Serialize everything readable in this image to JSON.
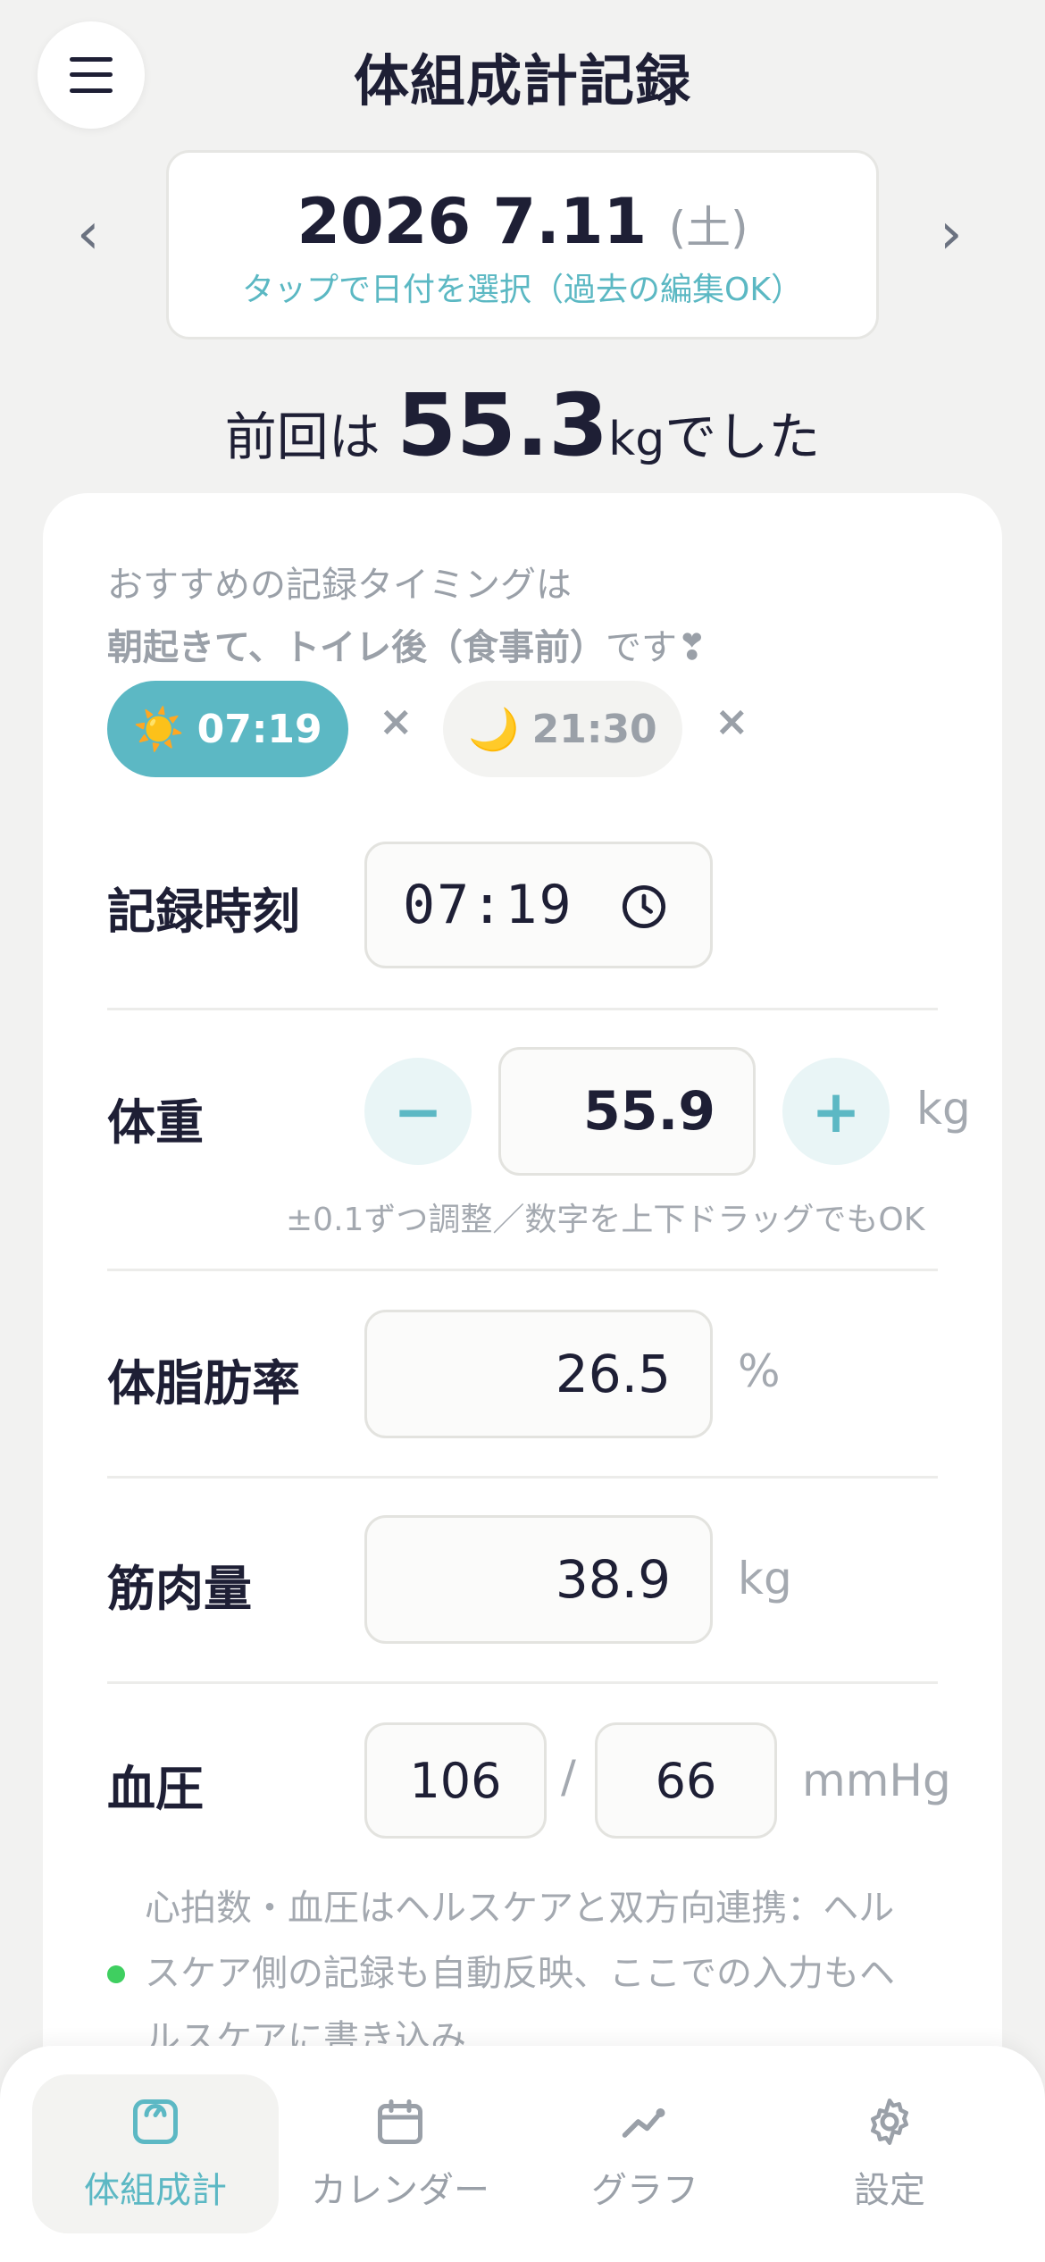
{
  "header": {
    "title": "体組成計記録",
    "menu_icon": "hamburger-menu-icon"
  },
  "date_nav": {
    "prev_glyph": "‹",
    "next_glyph": "›",
    "date": "2026 7.11",
    "weekday": "(土)",
    "hint": "タップで日付を選択（過去の編集OK）"
  },
  "previous": {
    "prefix": "前回は",
    "value": "55.3",
    "unit": "kg",
    "suffix": "でした"
  },
  "timing": {
    "line1": "おすすめの記録タイミングは",
    "line2_bold": "朝起きて、トイレ後（食事前）",
    "line2_rest": "です❣",
    "morning": {
      "emoji": "☀️",
      "time": "07:19"
    },
    "night": {
      "emoji": "🌙",
      "time": "21:30"
    },
    "remove_glyph": "×"
  },
  "record_time": {
    "label": "記録時刻",
    "value": "07:19"
  },
  "weight": {
    "label": "体重",
    "minus": "−",
    "plus": "+",
    "value": "55.9",
    "unit": "kg",
    "hint": "±0.1ずつ調整／数字を上下ドラッグでもOK"
  },
  "body_fat": {
    "label": "体脂肪率",
    "value": "26.5",
    "unit": "%"
  },
  "muscle": {
    "label": "筋肉量",
    "value": "38.9",
    "unit": "kg"
  },
  "blood_pressure": {
    "label": "血圧",
    "systolic": "106",
    "separator": "/",
    "diastolic": "66",
    "unit": "mmHg"
  },
  "note": {
    "text": "心拍数・血圧はヘルスケアと双方向連携：ヘルスケア側の記録も自動反映、ここでの入力もヘルスケアに書き込み"
  },
  "tabs": [
    {
      "label": "体組成計",
      "icon": "scale-icon",
      "active": true
    },
    {
      "label": "カレンダー",
      "icon": "calendar-icon",
      "active": false
    },
    {
      "label": "グラフ",
      "icon": "chart-line-icon",
      "active": false
    },
    {
      "label": "設定",
      "icon": "gear-icon",
      "active": false
    }
  ],
  "colors": {
    "accent": "#5cb8c4",
    "text": "#1e1f35",
    "muted": "#9aa0a8",
    "background": "#f2f2f1",
    "status_dot": "#3fcf60"
  }
}
